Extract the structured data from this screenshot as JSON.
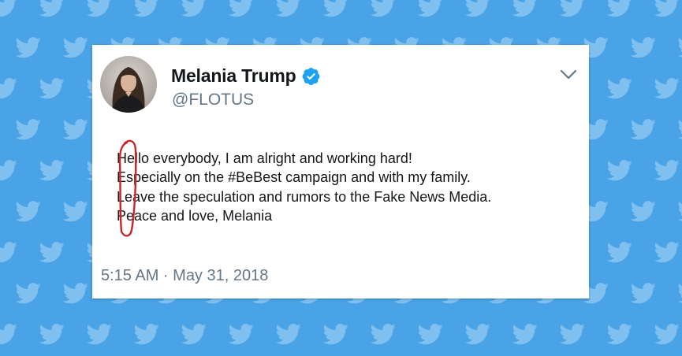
{
  "tweet": {
    "display_name": "Melania Trump",
    "handle": "@FLOTUS",
    "text_lines": [
      "Hello everybody, I am alright and working hard!",
      "Especially on the #BeBest campaign and with my family.",
      "Leave the speculation and rumors to the Fake News Media.",
      "Peace and love, Melania"
    ],
    "timestamp": "5:15 AM · May 31, 2018"
  },
  "icons": {
    "verified": "verified-badge-icon",
    "menu": "chevron-down-icon",
    "background": "bird-icon"
  },
  "colors": {
    "background": "#4aa3e6",
    "bird": "#7fc0f1",
    "verified": "#1da1f2",
    "annotation": "#c9252c",
    "secondary_text": "#657786",
    "primary_text": "#14171a"
  }
}
